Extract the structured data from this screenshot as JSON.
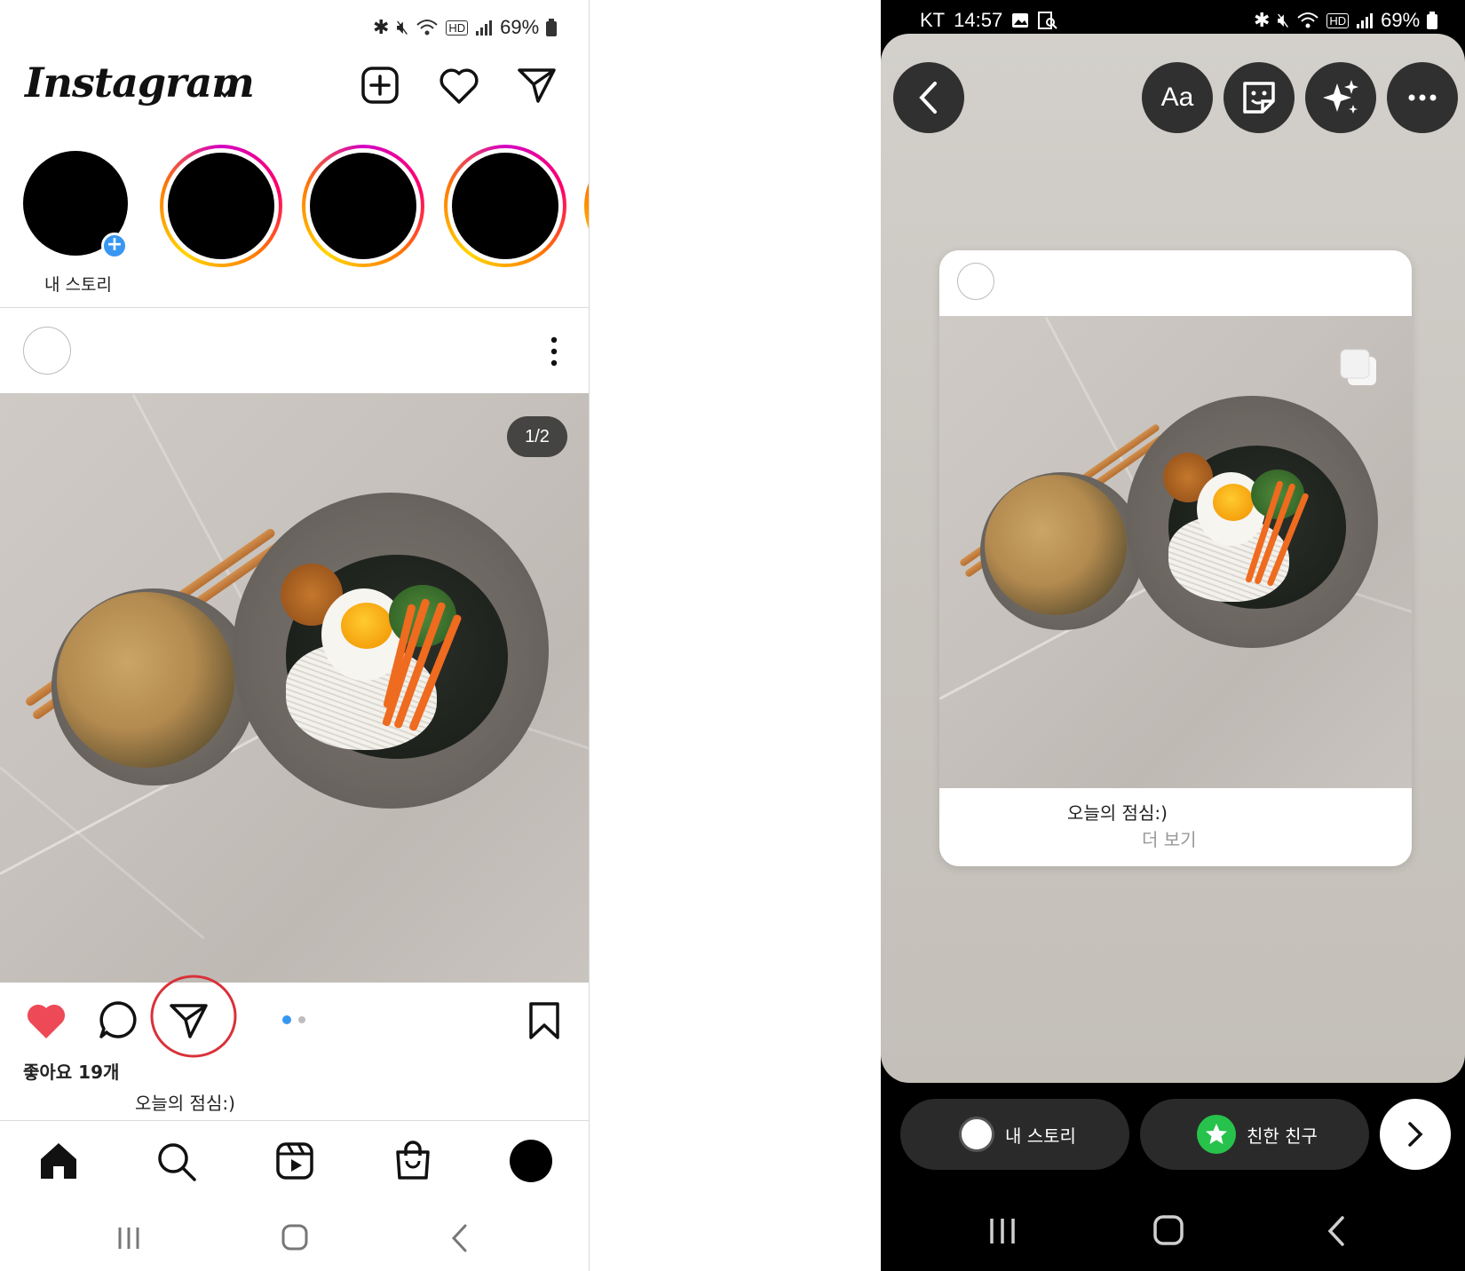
{
  "left": {
    "status": {
      "battery": "69%"
    },
    "header": {
      "logo": "Instagram"
    },
    "stories": [
      {
        "label": "내 스토리"
      }
    ],
    "post": {
      "counter": "1/2",
      "likes": "좋아요 19개",
      "caption": "오늘의 점심:)"
    }
  },
  "right": {
    "status": {
      "carrier": "KT",
      "time": "14:57",
      "battery": "69%"
    },
    "toolbar": {
      "text_button": "Aa"
    },
    "card": {
      "caption": "오늘의 점심:)",
      "more": "더 보기"
    },
    "share": {
      "my_story": "내 스토리",
      "close_friends": "친한 친구"
    }
  },
  "colors": {
    "like_red": "#ed4956",
    "highlight_circle": "#d8323a",
    "close_friends_green": "#27c24c",
    "blue_dot": "#3897f0"
  }
}
